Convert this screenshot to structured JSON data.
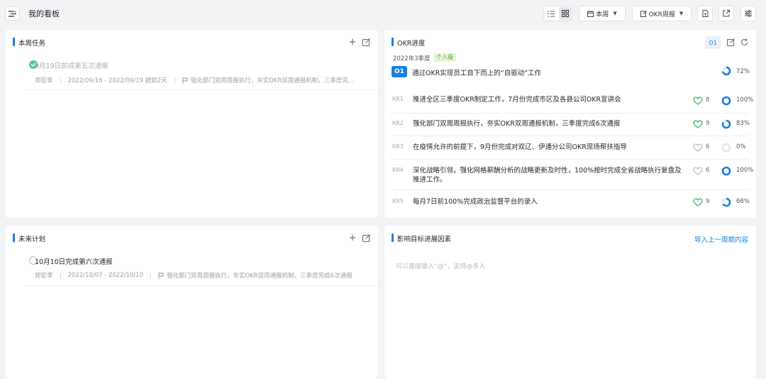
{
  "header": {
    "title": "我的看板",
    "week_label": "本周",
    "report_label": "OKR周报"
  },
  "this_week": {
    "title": "本周任务",
    "tasks": [
      {
        "title": "9月19日前成第五次通报",
        "owner": "郑宏李",
        "date_range": "2022/09/16 - 2022/09/19 提前2天",
        "link": "强化部门双周周报执行，夯实OKR双周通报机制，三季度完...",
        "done": true
      }
    ]
  },
  "future": {
    "title": "未来计划",
    "tasks": [
      {
        "title": "10月10日完成第六次通报",
        "owner": "郑宏李",
        "date_range": "2022/10/07 - 2022/10/10",
        "link": "强化部门双周周报执行，夯实OKR双周通报机制，三季度完成6次通报",
        "done": false
      }
    ]
  },
  "okr": {
    "title": "OKR进度",
    "tab_label": "O1",
    "quarter": "2022年3季度",
    "level": "个人级",
    "objective": {
      "badge": "O1",
      "text": "通过OKR实现员工自下而上的“自驱动”工作",
      "progress": 72,
      "progress_label": "72%"
    },
    "key_results": [
      {
        "label": "KR1",
        "text": "推进全区三季度OKR制定工作，7月份完成市区及各县公司OKR宣讲会",
        "likes": "8",
        "liked": true,
        "progress": 100,
        "progress_label": "100%"
      },
      {
        "label": "KR2",
        "text": "强化部门双周周报执行，夯实OKR双周通报机制，三季度完成6次通报",
        "likes": "9",
        "liked": true,
        "progress": 83,
        "progress_label": "83%"
      },
      {
        "label": "KR3",
        "text": "在疫情允许的前提下，9月份完成对双辽、伊通分公司OKR现场帮扶指导",
        "likes": "6",
        "liked": false,
        "progress": 0,
        "progress_label": "0%"
      },
      {
        "label": "KR4",
        "text": "深化战略引领，强化网格薪酬分析的战略更新及时性，100%按时完成全省战略执行复盘及推进工作。",
        "likes": "6",
        "liked": false,
        "progress": 100,
        "progress_label": "100%"
      },
      {
        "label": "KR5",
        "text": "每月7日前100%完成政治监督平台的录入",
        "likes": "9",
        "liked": true,
        "progress": 66,
        "progress_label": "66%"
      }
    ]
  },
  "factors": {
    "title": "影响目标进展因素",
    "import_label": "导入上一周期内容",
    "placeholder": "可以直接输入“@”，支持@多人"
  },
  "colors": {
    "accent": "#1a7fe0",
    "liked": "#3cb85a",
    "done": "#5cc88f",
    "ring_track": "#e3e6ea"
  }
}
